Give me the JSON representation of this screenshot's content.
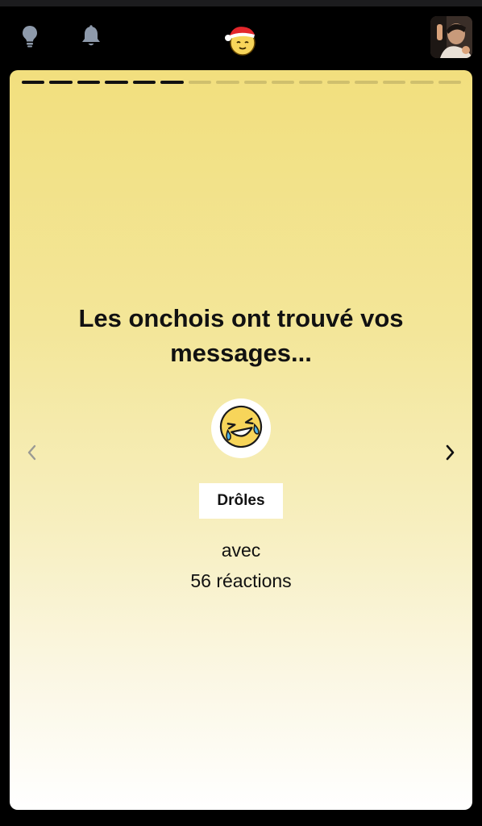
{
  "topbar": {
    "icons": [
      "lightbulb-icon",
      "bell-icon",
      "santa-smiley-logo",
      "user-avatar"
    ]
  },
  "story": {
    "progress_total": 16,
    "progress_done": 6,
    "title": "Les onchois ont trouvé vos messages...",
    "emoji": "rolling-on-floor-laughing-icon",
    "category": "Drôles",
    "avec": "avec",
    "count": "56",
    "reactions_label": "réactions"
  },
  "colors": {
    "card_top": "#f2df7e",
    "card_bottom": "#ffffff",
    "icon_gray": "#8e9aab",
    "progress_done": "#111111"
  }
}
